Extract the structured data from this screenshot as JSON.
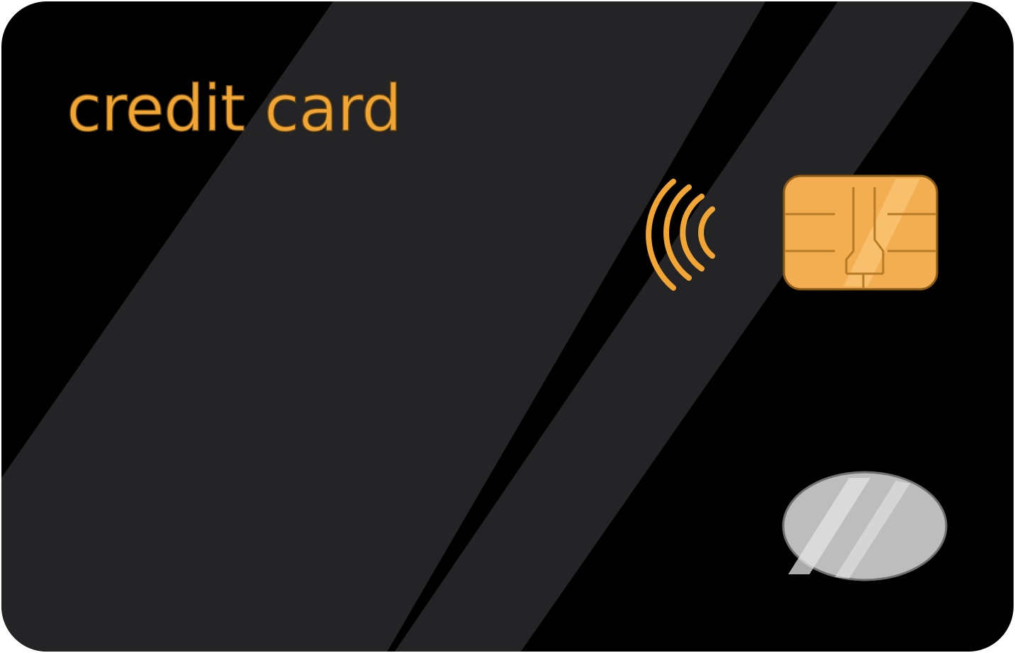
{
  "card": {
    "title": "credit card"
  },
  "colors": {
    "card_base": "#000000",
    "stripe": "#242426",
    "accent_gold": "#f1a534",
    "chip_gold": "#f3ae52",
    "chip_line": "#b87a24",
    "emblem_silver": "#bdbdbd"
  },
  "icons": {
    "contactless": "contactless-payment-icon",
    "chip": "emv-chip-icon",
    "emblem": "oval-emblem-icon"
  }
}
